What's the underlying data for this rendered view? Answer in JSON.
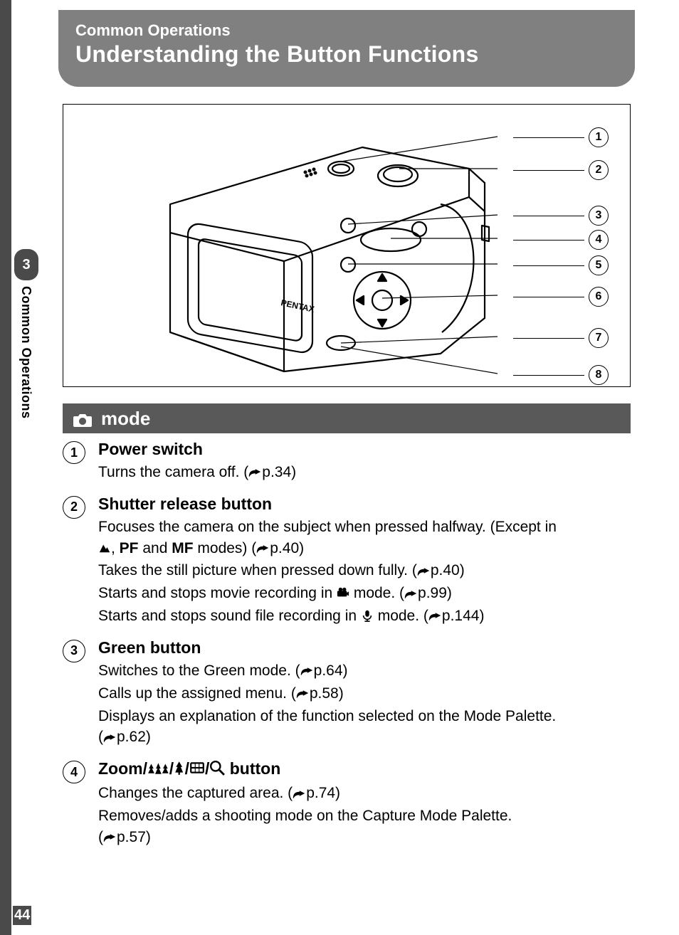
{
  "page_number": "44",
  "side_tab": {
    "number": "3",
    "label": "Common Operations"
  },
  "title": {
    "section": "Common Operations",
    "chapter": "Understanding the Button Functions"
  },
  "diagram": {
    "brand": "PENTAX",
    "callouts": [
      "1",
      "2",
      "3",
      "4",
      "5",
      "6",
      "7",
      "8"
    ]
  },
  "mode_bar": {
    "label": "mode"
  },
  "items": [
    {
      "num": "1",
      "heading": "Power switch",
      "lines": [
        {
          "segments": [
            {
              "t": "Turns the camera off. ("
            },
            {
              "icon": "ref"
            },
            {
              "t": "p.34)"
            }
          ]
        }
      ]
    },
    {
      "num": "2",
      "heading": "Shutter release button",
      "lines": [
        {
          "segments": [
            {
              "t": "Focuses the camera on the subject when pressed halfway. (Except in "
            }
          ]
        },
        {
          "segments": [
            {
              "icon": "mountain"
            },
            {
              "t": ", "
            },
            {
              "t": "PF",
              "bold": true
            },
            {
              "t": " and "
            },
            {
              "t": "MF",
              "bold": true
            },
            {
              "t": " modes) ("
            },
            {
              "icon": "ref"
            },
            {
              "t": "p.40)"
            }
          ]
        },
        {
          "segments": [
            {
              "t": "Takes the still picture when pressed down fully. ("
            },
            {
              "icon": "ref"
            },
            {
              "t": "p.40)"
            }
          ]
        },
        {
          "segments": [
            {
              "t": "Starts and stops movie recording in "
            },
            {
              "icon": "movie"
            },
            {
              "t": " mode. ("
            },
            {
              "icon": "ref"
            },
            {
              "t": "p.99)"
            }
          ]
        },
        {
          "segments": [
            {
              "t": "Starts and stops sound file recording in "
            },
            {
              "icon": "mic"
            },
            {
              "t": " mode. ("
            },
            {
              "icon": "ref"
            },
            {
              "t": "p.144)"
            }
          ]
        }
      ]
    },
    {
      "num": "3",
      "heading": "Green button",
      "lines": [
        {
          "segments": [
            {
              "t": "Switches to the Green mode. ("
            },
            {
              "icon": "ref"
            },
            {
              "t": "p.64)"
            }
          ]
        },
        {
          "segments": [
            {
              "t": "Calls up the assigned menu. ("
            },
            {
              "icon": "ref"
            },
            {
              "t": "p.58)"
            }
          ]
        },
        {
          "segments": [
            {
              "t": "Displays an explanation of the function selected on the Mode Palette."
            }
          ]
        },
        {
          "segments": [
            {
              "t": "("
            },
            {
              "icon": "ref"
            },
            {
              "t": "p.62)"
            }
          ]
        }
      ]
    },
    {
      "num": "4",
      "heading_segments": [
        {
          "t": "Zoom/"
        },
        {
          "icon": "trees3"
        },
        {
          "t": "/"
        },
        {
          "icon": "tree1"
        },
        {
          "t": "/"
        },
        {
          "icon": "grid"
        },
        {
          "t": "/"
        },
        {
          "icon": "magnify"
        },
        {
          "t": " button"
        }
      ],
      "lines": [
        {
          "segments": [
            {
              "t": "Changes the captured area. ("
            },
            {
              "icon": "ref"
            },
            {
              "t": "p.74)"
            }
          ]
        },
        {
          "segments": [
            {
              "t": "Removes/adds a shooting mode on the Capture Mode Palette."
            }
          ]
        },
        {
          "segments": [
            {
              "t": "("
            },
            {
              "icon": "ref"
            },
            {
              "t": "p.57)"
            }
          ]
        }
      ]
    }
  ]
}
